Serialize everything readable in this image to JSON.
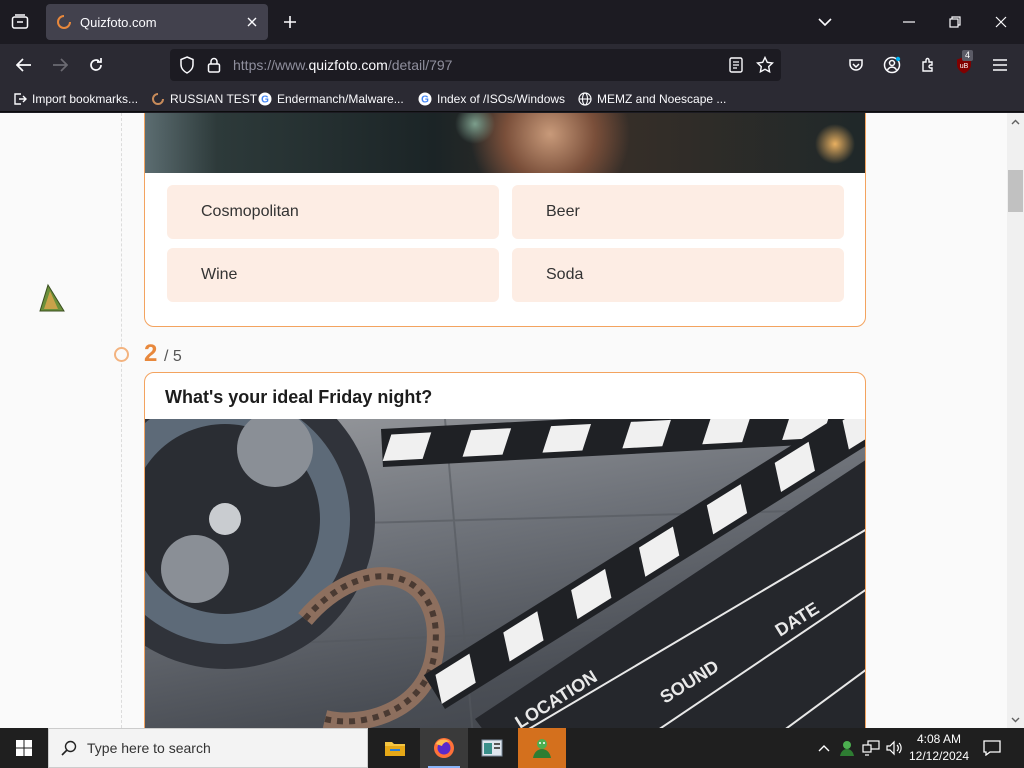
{
  "browser": {
    "tab_title": "Quizfoto.com",
    "url_prefix": "https://www.",
    "url_host": "quizfoto.com",
    "url_path": "/detail/797",
    "extension_badge": "4",
    "bookmarks": [
      {
        "label": "Import bookmarks...",
        "icon": "import-icon"
      },
      {
        "label": "RUSSIAN TEST",
        "icon": "site-favicon"
      },
      {
        "label": "Endermanch/Malware...",
        "icon": "google-icon"
      },
      {
        "label": "Index of /ISOs/Windows",
        "icon": "google-icon"
      },
      {
        "label": "MEMZ and Noescape ...",
        "icon": "globe-icon"
      }
    ]
  },
  "quiz": {
    "q1_options": [
      "Cosmopolitan",
      "Beer",
      "Wine",
      "Soda"
    ],
    "q2_number": "2",
    "q2_total": "/ 5",
    "q2_title": "What's your ideal Friday night?",
    "clapper_labels": [
      "LOCATION",
      "SOUND",
      "DATE"
    ]
  },
  "taskbar": {
    "search_placeholder": "Type here to search",
    "time": "4:08 AM",
    "date": "12/12/2024"
  },
  "colors": {
    "accent": "#e8883c",
    "card_border": "#f3a35f",
    "option_bg": "#fdede4"
  }
}
